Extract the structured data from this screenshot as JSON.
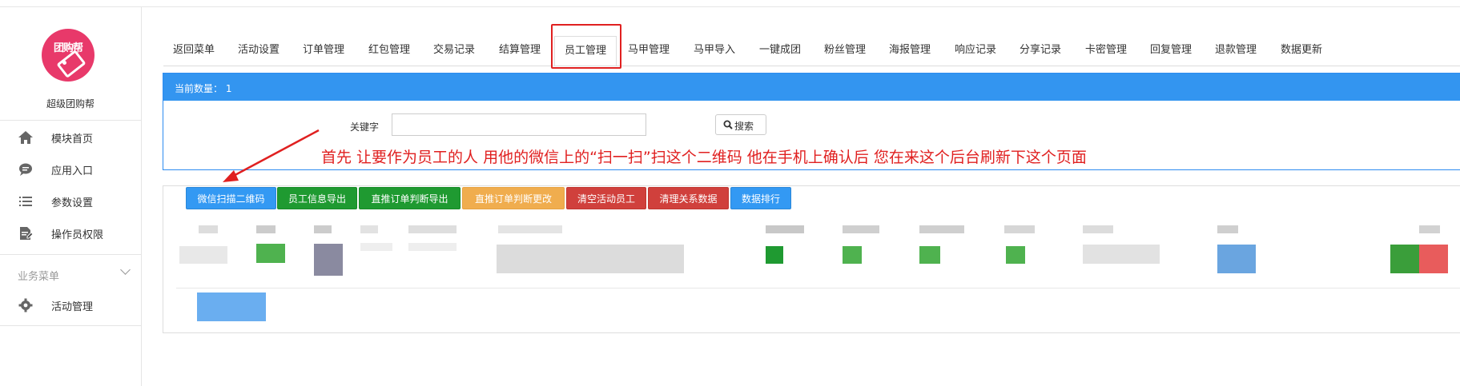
{
  "sidebar": {
    "logo_text": "团购帮",
    "app_name": "超级团购帮",
    "items": [
      {
        "label": "模块首页",
        "icon": "home-icon"
      },
      {
        "label": "应用入口",
        "icon": "chat-bubble-icon"
      },
      {
        "label": "参数设置",
        "icon": "list-settings-icon"
      },
      {
        "label": "操作员权限",
        "icon": "document-edit-icon"
      }
    ],
    "group_label": "业务菜单",
    "group_items": [
      {
        "label": "活动管理",
        "icon": "gear-icon"
      }
    ]
  },
  "tabs": [
    {
      "label": "返回菜单",
      "active": false
    },
    {
      "label": "活动设置",
      "active": false
    },
    {
      "label": "订单管理",
      "active": false
    },
    {
      "label": "红包管理",
      "active": false
    },
    {
      "label": "交易记录",
      "active": false
    },
    {
      "label": "结算管理",
      "active": false
    },
    {
      "label": "员工管理",
      "active": true
    },
    {
      "label": "马甲管理",
      "active": false
    },
    {
      "label": "马甲导入",
      "active": false
    },
    {
      "label": "一键成团",
      "active": false
    },
    {
      "label": "粉丝管理",
      "active": false
    },
    {
      "label": "海报管理",
      "active": false
    },
    {
      "label": "响应记录",
      "active": false
    },
    {
      "label": "分享记录",
      "active": false
    },
    {
      "label": "卡密管理",
      "active": false
    },
    {
      "label": "回复管理",
      "active": false
    },
    {
      "label": "退款管理",
      "active": false
    },
    {
      "label": "数据更新",
      "active": false
    }
  ],
  "panel": {
    "count_text": "当前数量：  1",
    "keyword_label": "关键字",
    "keyword_value": "",
    "search_button": "搜索"
  },
  "annotation": "首先 让要作为员工的人 用他的微信上的“扫一扫”扫这个二维码   他在手机上确认后   您在来这个后台刷新下这个页面",
  "actions": [
    {
      "label": "微信扫描二维码",
      "color": "#3399f3"
    },
    {
      "label": "员工信息导出",
      "color": "#1f9a31"
    },
    {
      "label": "直推订单判断导出",
      "color": "#1f9a31"
    },
    {
      "label": "直推订单判断更改",
      "color": "#f0ad4e"
    },
    {
      "label": "清空活动员工",
      "color": "#d0403c"
    },
    {
      "label": "清理关系数据",
      "color": "#d0403c"
    },
    {
      "label": "数据排行",
      "color": "#3399f3"
    }
  ],
  "colors": {
    "accent_blue": "#3395f0",
    "annotation_red": "#e02020",
    "logo_pink": "#e8396a"
  }
}
